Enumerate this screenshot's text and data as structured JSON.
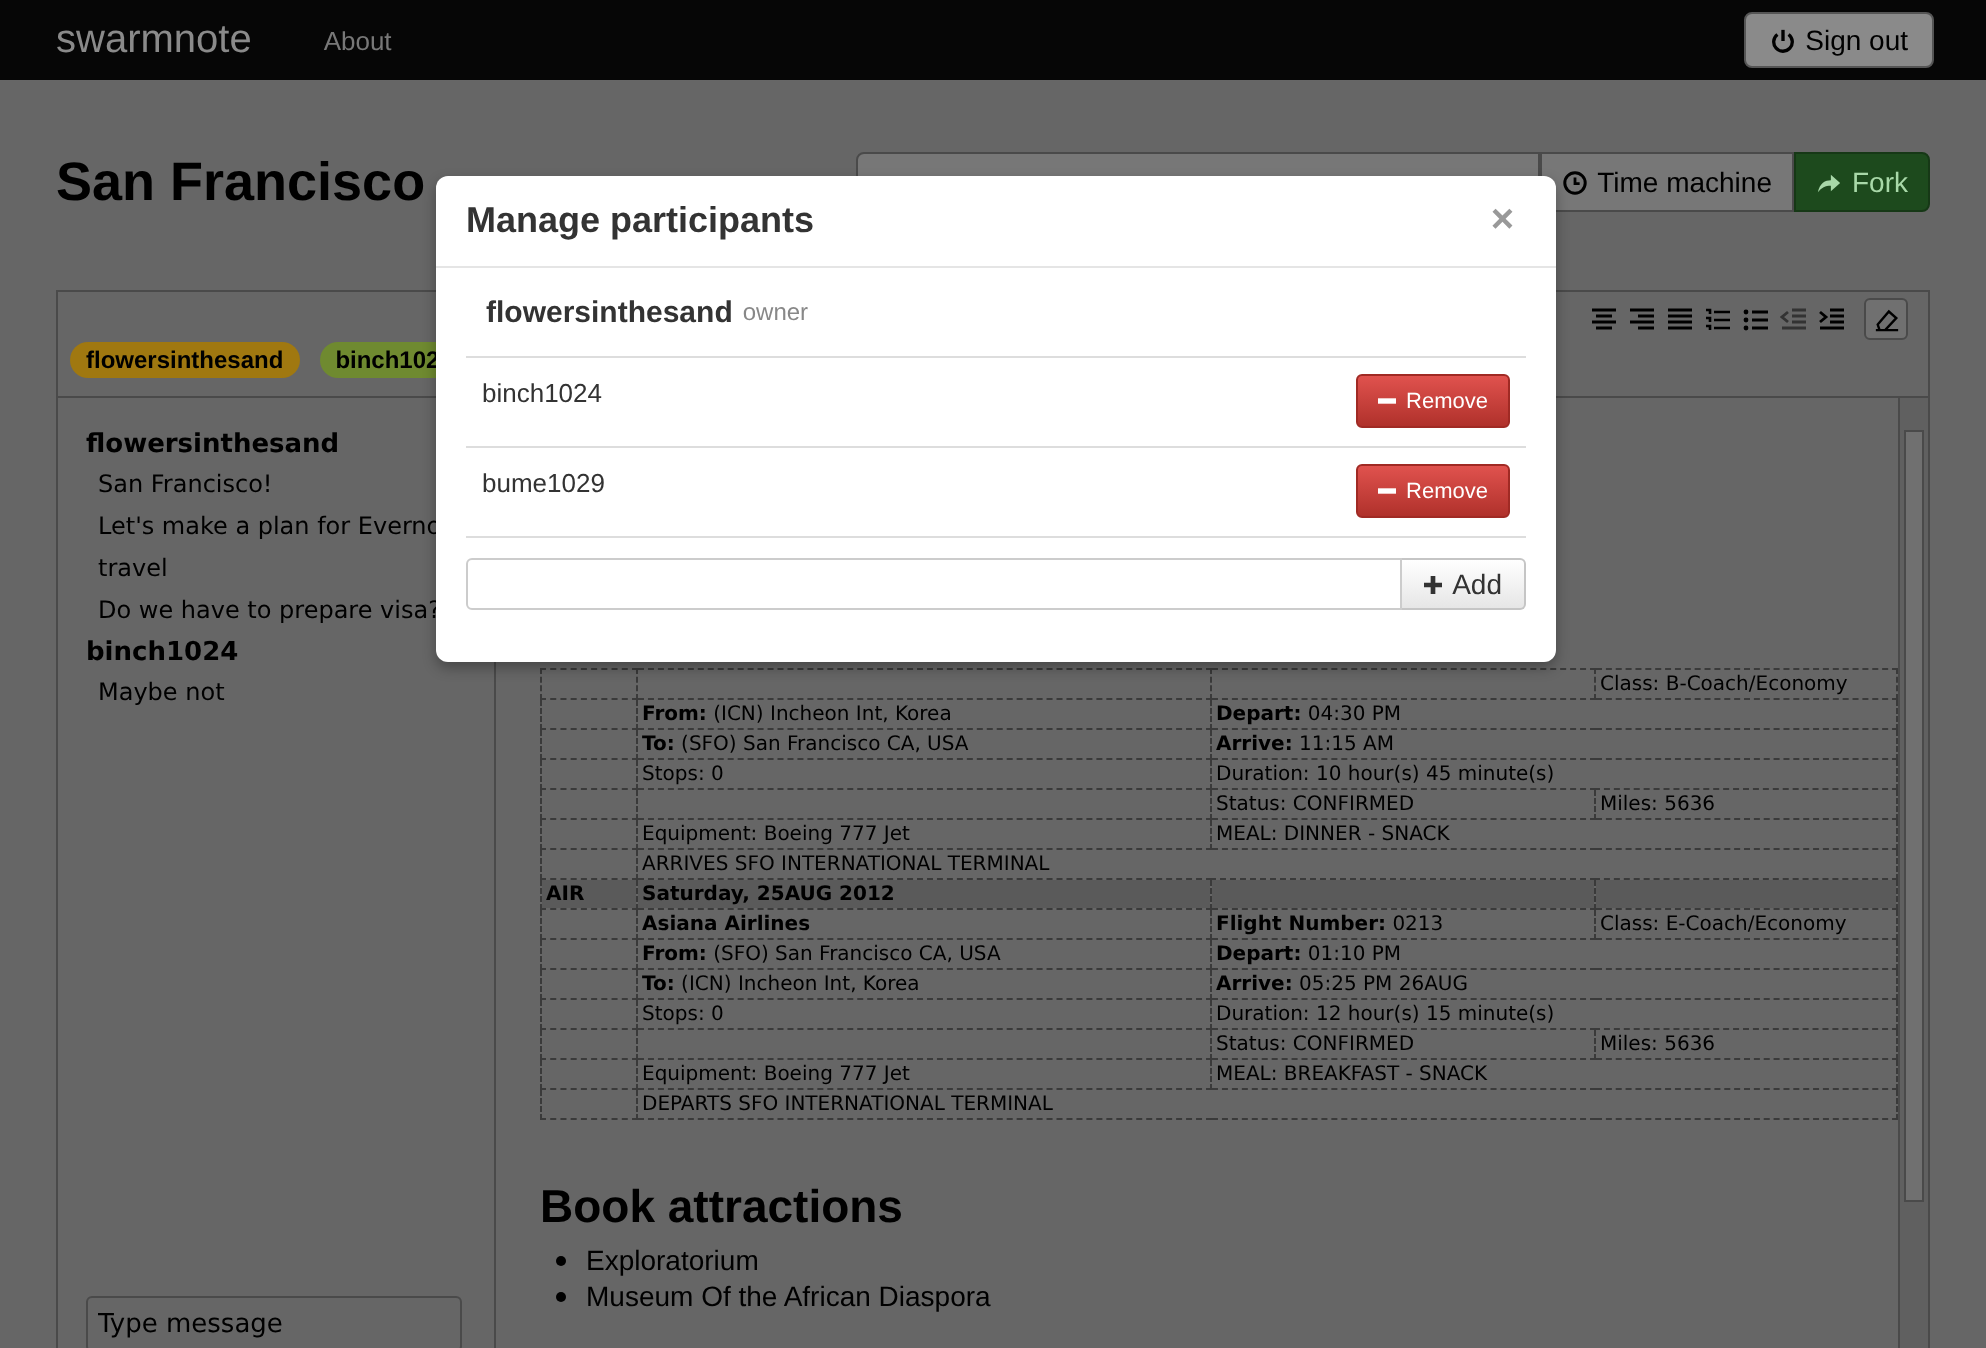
{
  "navbar": {
    "brand": "swarmnote",
    "links": [
      {
        "label": "About"
      }
    ],
    "sign_out": "Sign out"
  },
  "page": {
    "title": "San Francisco",
    "actions": [
      {
        "kind": "history",
        "label": "Time machine"
      },
      {
        "kind": "fork",
        "label": "Fork"
      }
    ]
  },
  "tags": [
    {
      "label": "flowersinthesand",
      "color": "#a07810"
    },
    {
      "label": "binch102",
      "color": "#6f8a30"
    }
  ],
  "chat": {
    "messages": [
      {
        "author": "flowersinthesand",
        "lines": [
          "San Francisco!",
          "Let's make a plan for Everno",
          "travel",
          "Do we have to prepare visa?"
        ]
      },
      {
        "author": "binch1024",
        "lines": [
          "Maybe not"
        ]
      }
    ],
    "input": {
      "placeholder": "Type message"
    }
  },
  "editor": {
    "rows": [
      {
        "kind": "detail",
        "cells": [
          "",
          "",
          "",
          "Class: B-Coach/Economy"
        ]
      },
      {
        "kind": "detail",
        "cells": [
          "",
          "**From:** (ICN) Incheon Int, Korea",
          {
            "text": "**Depart:** 04:30 PM",
            "colspan": 2
          }
        ]
      },
      {
        "kind": "detail",
        "cells": [
          "",
          "**To:** (SFO) San Francisco CA, USA",
          {
            "text": "**Arrive:** 11:15 AM",
            "colspan": 2
          }
        ]
      },
      {
        "kind": "detail",
        "cells": [
          "",
          "Stops: 0",
          {
            "text": "Duration: 10 hour(s) 45 minute(s)",
            "colspan": 2
          }
        ]
      },
      {
        "kind": "detail",
        "cells": [
          "",
          "",
          "Status: CONFIRMED",
          "Miles: 5636"
        ]
      },
      {
        "kind": "detail",
        "cells": [
          "",
          "Equipment: Boeing 777 Jet",
          {
            "text": "MEAL: DINNER - SNACK",
            "colspan": 2
          }
        ]
      },
      {
        "kind": "detail",
        "cells": [
          "",
          {
            "text": "ARRIVES SFO INTERNATIONAL TERMINAL",
            "colspan": 3
          }
        ]
      },
      {
        "kind": "header",
        "cells": [
          "AIR",
          "Saturday, 25AUG 2012",
          "",
          ""
        ]
      },
      {
        "kind": "detail",
        "cells": [
          "",
          "**Asiana Airlines**",
          "**Flight Number:** 0213",
          "Class: E-Coach/Economy"
        ]
      },
      {
        "kind": "detail",
        "cells": [
          "",
          "**From:** (SFO) San Francisco CA, USA",
          {
            "text": "**Depart:** 01:10 PM",
            "colspan": 2
          }
        ]
      },
      {
        "kind": "detail",
        "cells": [
          "",
          "**To:** (ICN) Incheon Int, Korea",
          {
            "text": "**Arrive:** 05:25 PM 26AUG",
            "colspan": 2
          }
        ]
      },
      {
        "kind": "detail",
        "cells": [
          "",
          "Stops: 0",
          {
            "text": "Duration: 12 hour(s) 15 minute(s)",
            "colspan": 2
          }
        ]
      },
      {
        "kind": "detail",
        "cells": [
          "",
          "",
          "Status: CONFIRMED",
          "Miles: 5636"
        ]
      },
      {
        "kind": "detail",
        "cells": [
          "",
          "Equipment: Boeing 777 Jet",
          {
            "text": "MEAL: BREAKFAST - SNACK",
            "colspan": 2
          }
        ]
      },
      {
        "kind": "detail",
        "cells": [
          "",
          {
            "text": "DEPARTS SFO INTERNATIONAL TERMINAL",
            "colspan": 3
          }
        ]
      }
    ],
    "heading": "Book attractions",
    "list": [
      "Exploratorium",
      "Museum Of the African Diaspora"
    ]
  },
  "modal": {
    "title": "Manage participants",
    "close": "×",
    "owner": {
      "name": "flowersinthesand",
      "role": "owner"
    },
    "participants": [
      {
        "name": "binch1024",
        "action": "Remove"
      },
      {
        "name": "bume1029",
        "action": "Remove"
      }
    ],
    "add_button": "Add"
  }
}
